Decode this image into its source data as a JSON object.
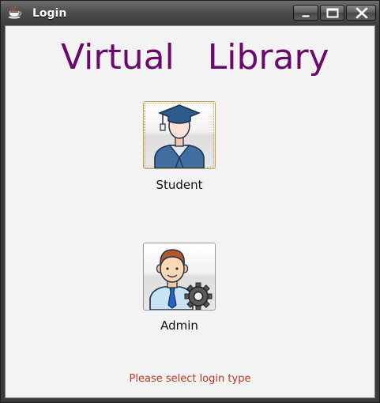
{
  "window": {
    "title": "Login",
    "icon": "coffee-cup-icon",
    "controls": [
      "minimize-icon",
      "maximize-icon",
      "close-icon"
    ]
  },
  "app": {
    "title": "Virtual   Library",
    "title_color": "#6a0a6a"
  },
  "login_options": {
    "student": {
      "label": "Student",
      "icon": "graduate-student-icon"
    },
    "admin": {
      "label": "Admin",
      "icon": "admin-gear-icon"
    }
  },
  "status": {
    "message": "Please select login type",
    "color": "#b3391f"
  }
}
